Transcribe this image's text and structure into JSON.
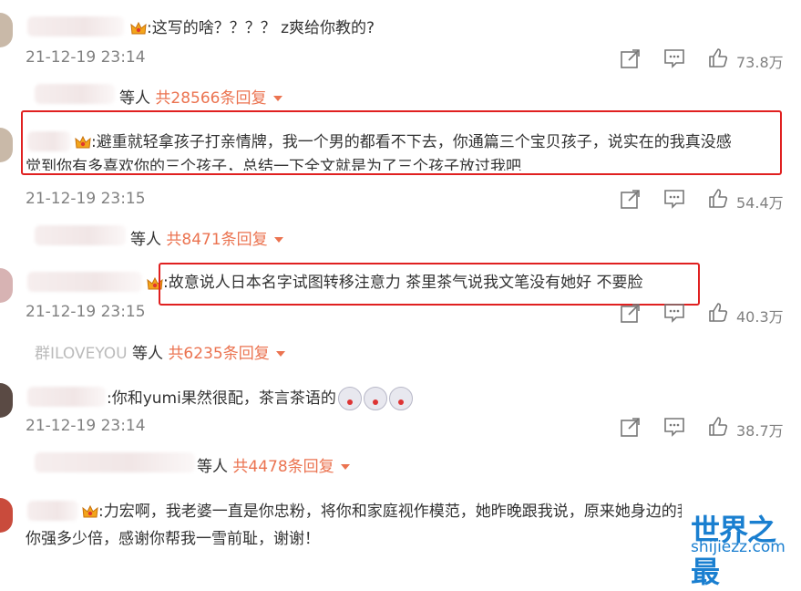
{
  "comments": [
    {
      "text_lines": [
        ":这写的啥？？？？ z爽给你教的?"
      ],
      "time": "21-12-19 23:14",
      "likes": "73.8万",
      "reply_prefix": "等人",
      "reply_count": "共28566条回复"
    },
    {
      "text_lines": [
        ":避重就轻拿孩子打亲情牌，我一个男的都看不下去，你通篇三个宝贝孩子，说实在的我真没感",
        "觉到你有多喜欢你的三个孩子，总结一下全文就是为了三个孩子放过我吧"
      ],
      "time": "21-12-19 23:15",
      "likes": "54.4万",
      "reply_prefix": "等人",
      "reply_count": "共8471条回复"
    },
    {
      "text_lines": [
        ":故意说人日本名字试图转移注意力 茶里茶气说我文笔没有她好 不要脸"
      ],
      "time": "21-12-19 23:15",
      "likes": "40.3万",
      "reply_user_fragment": "群ILOVEYOU",
      "reply_prefix": "等人",
      "reply_count": "共6235条回复"
    },
    {
      "text_lines": [
        ":你和yumi果然很配，茶言茶语的"
      ],
      "time": "21-12-19 23:14",
      "likes": "38.7万",
      "reply_prefix": "等人",
      "reply_count": "共4478条回复"
    },
    {
      "text_lines": [
        ":力宏啊，我老婆一直是你忠粉，将你和家庭视作模范，她昨晚跟我说，原来她身边的我不知比",
        "你强多少倍，感谢你帮我一雪前耻，谢谢！"
      ]
    }
  ],
  "watermark": {
    "title": "世界之最",
    "url": "shijiezz.com"
  },
  "colors": {
    "accent": "#eb7350",
    "highlight": "#e02020",
    "meta": "#808080"
  },
  "icons": [
    "share-icon",
    "comment-icon",
    "like-icon",
    "crown-badge-icon",
    "dropdown-arrow-icon",
    "emoji-icon"
  ]
}
